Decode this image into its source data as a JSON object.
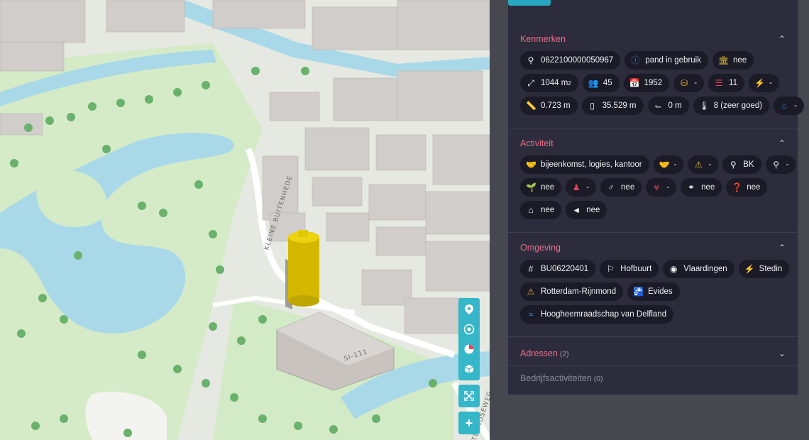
{
  "map": {
    "street_labels": [
      "KLEINE BUITENHEDE",
      "SI-111",
      "WESTLANDSEWEG"
    ],
    "controls": [
      {
        "icon": "location-pin-icon"
      },
      {
        "icon": "target-icon"
      },
      {
        "icon": "compass-icon"
      },
      {
        "icon": "cube-icon"
      },
      {
        "icon": "fullscreen-icon"
      },
      {
        "icon": "zoom-in-icon",
        "label": "+"
      }
    ],
    "colors": {
      "water": "#a9d9e8",
      "park": "#d4ebc6",
      "selected_building": "#e0c400",
      "buildings": "#cfcbc8"
    }
  },
  "panel": {
    "accent": "#e46f87",
    "kenmerken": {
      "title": "Kenmerken",
      "row1": [
        "0622100000050967",
        "pand in gebruik",
        "nee"
      ],
      "row2": {
        "area": "1044 m",
        "area_sup": "2",
        "people": "45",
        "year": "1952",
        "energy": "-",
        "layers": "11",
        "plug": "-"
      },
      "row3": [
        "0.723 m",
        "35.529 m",
        "0 m",
        "8 (zeer goed)",
        "-"
      ]
    },
    "activiteit": {
      "title": "Activiteit",
      "row1": [
        "bijeenkomst, logies, kantoor",
        "-",
        "-",
        "BK",
        "-"
      ],
      "row2": [
        "nee",
        "-",
        "nee",
        "-",
        "nee",
        "nee"
      ],
      "row3": [
        "nee",
        "nee"
      ]
    },
    "omgeving": {
      "title": "Omgeving",
      "row1": [
        "BU06220401",
        "Hofbuurt",
        "Vlaardingen",
        "Stedin"
      ],
      "row2": [
        "Rotterdam-Rijnmond",
        "Evides"
      ],
      "row3": [
        "Hoogheemraadschap van Delfland"
      ]
    },
    "adressen": {
      "title": "Adressen",
      "count": "(2)"
    },
    "bedrijf": {
      "title": "Bedrijfsactiviteiten",
      "count": "(0)"
    }
  }
}
